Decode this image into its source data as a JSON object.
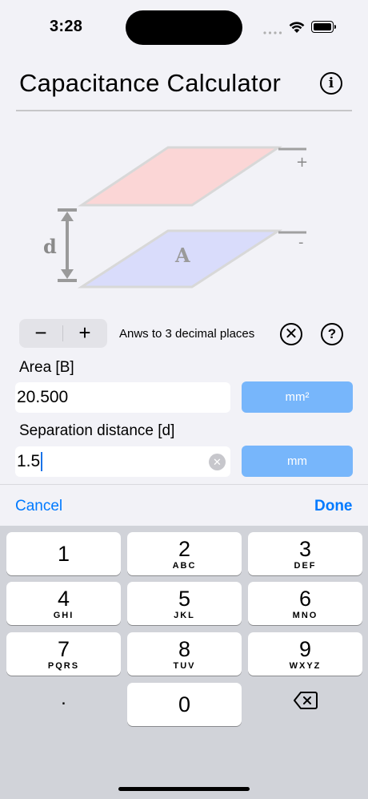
{
  "status": {
    "time": "3:28"
  },
  "header": {
    "title": "Capacitance Calculator",
    "info_icon": "info-circle-icon"
  },
  "diagram": {
    "height_label": "d",
    "area_label": "A",
    "top_terminal": "+",
    "bottom_terminal": "-",
    "colors": {
      "top_plate": "#fbd6d6",
      "bottom_plate": "#d9dcfb",
      "outline": "#d8d8d8",
      "arrow": "#9a9a9a"
    }
  },
  "controls": {
    "minus": "−",
    "plus": "+",
    "decimals_text": "Anws to 3 decimal places",
    "clear_icon": "⊗",
    "help_label": "?"
  },
  "fields": {
    "area": {
      "label": "Area [B]",
      "value": "20.500",
      "unit": "mm²"
    },
    "separation": {
      "label": "Separation distance [d]",
      "value": "1.5",
      "unit": "mm"
    }
  },
  "toolbar": {
    "cancel": "Cancel",
    "done": "Done"
  },
  "keyboard": {
    "keys": [
      {
        "num": "1",
        "letters": ""
      },
      {
        "num": "2",
        "letters": "ABC"
      },
      {
        "num": "3",
        "letters": "DEF"
      },
      {
        "num": "4",
        "letters": "GHI"
      },
      {
        "num": "5",
        "letters": "JKL"
      },
      {
        "num": "6",
        "letters": "MNO"
      },
      {
        "num": "7",
        "letters": "PQRS"
      },
      {
        "num": "8",
        "letters": "TUV"
      },
      {
        "num": "9",
        "letters": "WXYZ"
      },
      {
        "num": "0",
        "letters": ""
      }
    ],
    "decimal": ".",
    "delete_icon": "backspace-icon"
  },
  "colors": {
    "accent": "#007aff",
    "unit_button": "#77b6fb"
  }
}
